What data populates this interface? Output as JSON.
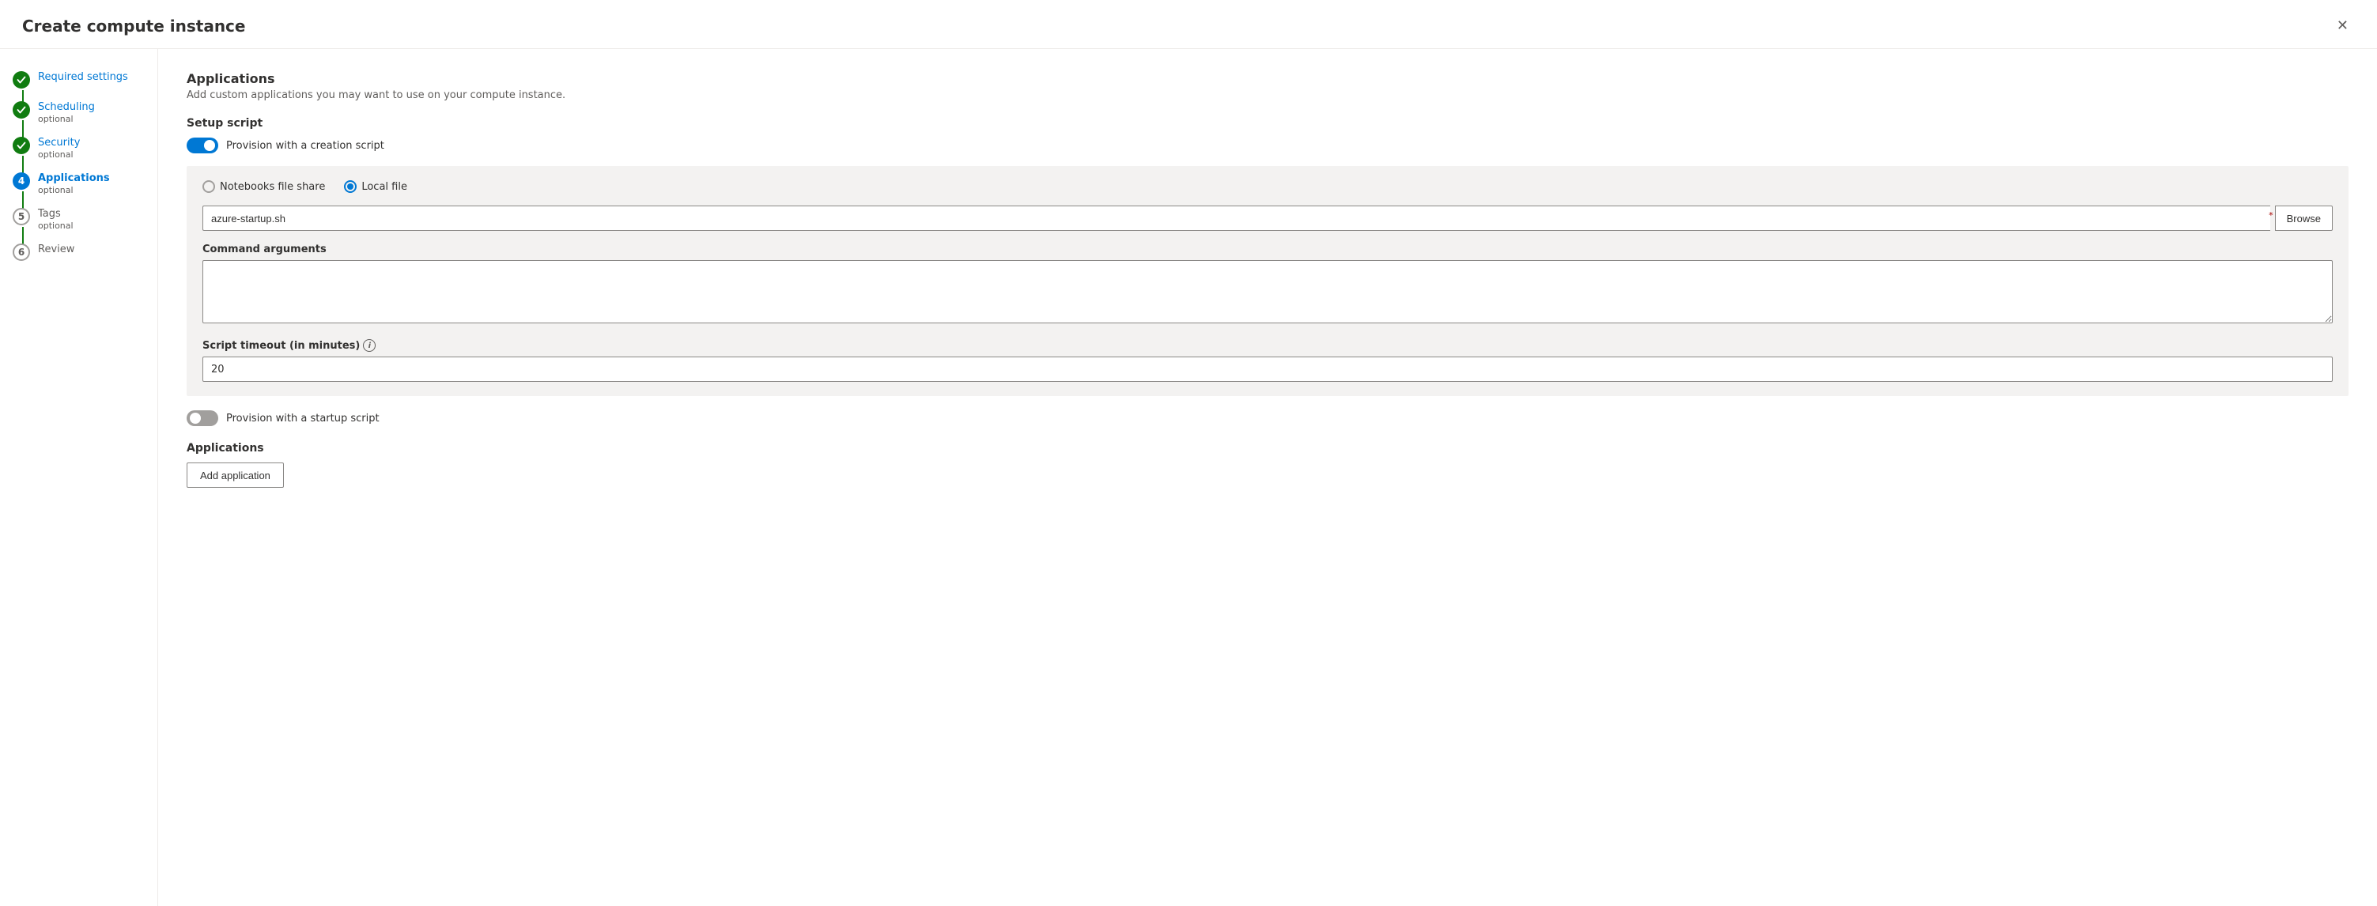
{
  "dialog": {
    "title": "Create compute instance",
    "close_label": "×"
  },
  "sidebar": {
    "items": [
      {
        "id": "required-settings",
        "step_number": null,
        "icon_type": "completed",
        "name": "Required settings",
        "sub": null
      },
      {
        "id": "scheduling",
        "step_number": null,
        "icon_type": "completed",
        "name": "Scheduling",
        "sub": "optional"
      },
      {
        "id": "security",
        "step_number": null,
        "icon_type": "completed",
        "name": "Security",
        "sub": "optional"
      },
      {
        "id": "applications",
        "step_number": "4",
        "icon_type": "active",
        "name": "Applications",
        "sub": "optional"
      },
      {
        "id": "tags",
        "step_number": "5",
        "icon_type": "inactive",
        "name": "Tags",
        "sub": "optional"
      },
      {
        "id": "review",
        "step_number": "6",
        "icon_type": "inactive",
        "name": "Review",
        "sub": null
      }
    ]
  },
  "main": {
    "section_title": "Applications",
    "section_desc": "Add custom applications you may want to use on your compute instance.",
    "setup_script": {
      "label": "Setup script",
      "toggle_label": "Provision with a creation script",
      "toggle_on": true,
      "radio_options": [
        {
          "id": "notebooks",
          "label": "Notebooks file share",
          "selected": false
        },
        {
          "id": "local",
          "label": "Local file",
          "selected": true
        }
      ],
      "file_input_value": "azure-startup.sh",
      "file_input_placeholder": "",
      "browse_label": "Browse",
      "command_args_label": "Command arguments",
      "command_args_value": "",
      "timeout_label": "Script timeout (in minutes)",
      "timeout_info": "i",
      "timeout_value": "20"
    },
    "startup_script": {
      "toggle_label": "Provision with a startup script",
      "toggle_on": false
    },
    "applications": {
      "label": "Applications",
      "add_button_label": "Add application"
    }
  }
}
